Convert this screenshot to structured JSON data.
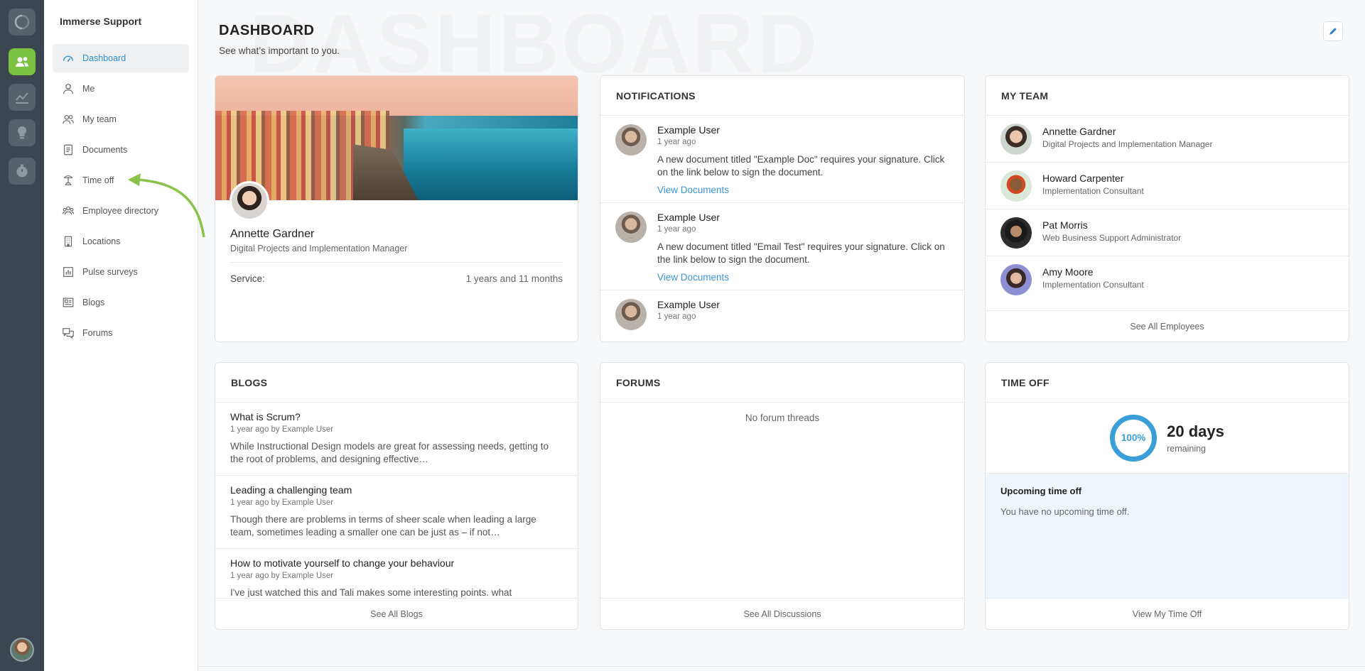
{
  "sidebar": {
    "org_name": "Immerse Support",
    "items": [
      {
        "label": "Dashboard",
        "icon": "dashboard-icon"
      },
      {
        "label": "Me",
        "icon": "person-icon"
      },
      {
        "label": "My team",
        "icon": "team-icon"
      },
      {
        "label": "Documents",
        "icon": "document-icon"
      },
      {
        "label": "Time off",
        "icon": "time-off-icon"
      },
      {
        "label": "Employee directory",
        "icon": "directory-icon"
      },
      {
        "label": "Locations",
        "icon": "building-icon"
      },
      {
        "label": "Pulse surveys",
        "icon": "bar-chart-icon"
      },
      {
        "label": "Blogs",
        "icon": "newspaper-icon"
      },
      {
        "label": "Forums",
        "icon": "forum-icon"
      }
    ]
  },
  "header": {
    "title": "DASHBOARD",
    "watermark": "DASHBOARD",
    "subtitle": "See what’s important to you."
  },
  "profile": {
    "name": "Annette Gardner",
    "role": "Digital Projects and Implementation Manager",
    "service_label": "Service:",
    "service_value": "1 years and 11 months"
  },
  "notifications": {
    "title": "NOTIFICATIONS",
    "items": [
      {
        "user": "Example User",
        "time": "1 year ago",
        "message": "A new document titled \"Example Doc\" requires your signature. Click on the link below to sign the document.",
        "link": "View Documents"
      },
      {
        "user": "Example User",
        "time": "1 year ago",
        "message": "A new document titled \"Email Test\" requires your signature. Click on the link below to sign the document.",
        "link": "View Documents"
      },
      {
        "user": "Example User",
        "time": "1 year ago"
      }
    ]
  },
  "team": {
    "title": "MY TEAM",
    "members": [
      {
        "name": "Annette Gardner",
        "role": "Digital Projects and Implementation Manager"
      },
      {
        "name": "Howard Carpenter",
        "role": "Implementation Consultant"
      },
      {
        "name": "Pat Morris",
        "role": "Web Business Support Administrator"
      },
      {
        "name": "Amy Moore",
        "role": "Implementation Consultant"
      }
    ],
    "footer": "See All Employees"
  },
  "blogs": {
    "title": "BLOGS",
    "items": [
      {
        "title": "What is Scrum?",
        "meta": "1 year ago by Example User",
        "excerpt": "While Instructional Design models are great for assessing needs, getting to the root of problems, and designing effective…"
      },
      {
        "title": "Leading a challenging team",
        "meta": "1 year ago by Example User",
        "excerpt": "Though there are problems in terms of sheer scale when leading a large team, sometimes leading a smaller one can be just as – if not…"
      },
      {
        "title": "How to motivate yourself to change your behaviour",
        "meta": "1 year ago by Example User",
        "excerpt": "I've just watched this and Tali makes some interesting points. what"
      }
    ],
    "footer": "See All Blogs"
  },
  "forums": {
    "title": "FORUMS",
    "empty": "No forum threads",
    "footer": "See All Discussions"
  },
  "timeoff": {
    "title": "TIME OFF",
    "percent": "100%",
    "days": "20 days",
    "remaining": "remaining",
    "upcoming_title": "Upcoming time off",
    "upcoming_text": "You have no upcoming time off.",
    "footer": "View My Time Off"
  },
  "colors": {
    "accent": "#3a9fd9",
    "rail": "#3c4650",
    "rail_active": "#7cc242",
    "arrow": "#8bc34a"
  }
}
